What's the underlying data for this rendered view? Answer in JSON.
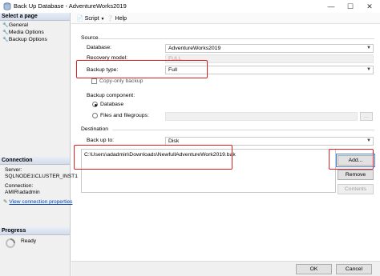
{
  "window": {
    "title": "Back Up Database - AdventureWorks2019",
    "icon": "database-icon",
    "controls": [
      "minimize-icon",
      "maximize-icon",
      "close-icon"
    ]
  },
  "left_pane": {
    "select_page_header": "Select a page",
    "pages": [
      {
        "label": "General",
        "icon": "wrench-icon"
      },
      {
        "label": "Media Options",
        "icon": "wrench-icon"
      },
      {
        "label": "Backup Options",
        "icon": "wrench-icon"
      }
    ],
    "connection_header": "Connection",
    "server_label": "Server:",
    "server_value": "SQLNODE1\\CLUSTER_INST1",
    "connection_label": "Connection:",
    "connection_value": "AMIR\\adadmin",
    "view_connection_properties": "View connection properties",
    "progress_header": "Progress",
    "progress_status": "Ready"
  },
  "toolbar": {
    "script_label": "Script",
    "help_label": "Help"
  },
  "source": {
    "group_label": "Source",
    "database_label": "Database:",
    "database_value": "AdventureWorks2019",
    "recovery_model_label": "Recovery model:",
    "recovery_model_value": "FULL",
    "backup_type_label": "Backup type:",
    "backup_type_value": "Full",
    "copy_only_label": "Copy-only backup",
    "copy_only_checked": false,
    "backup_component_label": "Backup component:",
    "component_database_label": "Database",
    "component_files_label": "Files and filegroups:",
    "component_selected": "Database",
    "browse_label": "..."
  },
  "destination": {
    "group_label": "Destination",
    "back_up_to_label": "Back up to:",
    "back_up_to_value": "Disk",
    "files": [
      "C:\\Users\\adadmin\\Downloads\\NewfullAdventureWork2019.bak"
    ],
    "add_label": "Add...",
    "remove_label": "Remove",
    "contents_label": "Contents"
  },
  "footer": {
    "ok_label": "OK",
    "cancel_label": "Cancel"
  },
  "colors": {
    "highlight_red": "#e02020",
    "highlight_blue": "#3c7fd6",
    "link": "#0645ad"
  }
}
